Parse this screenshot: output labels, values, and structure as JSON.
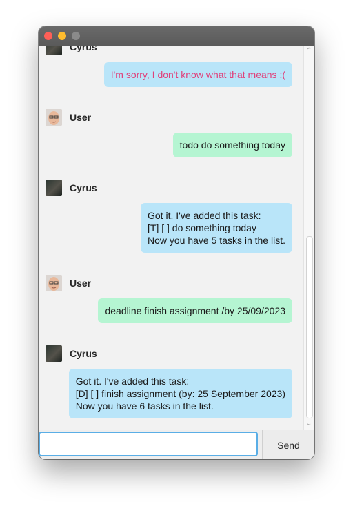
{
  "window": {
    "controls": [
      "close",
      "minimize",
      "maximize"
    ]
  },
  "messages": [
    {
      "sender": "Cyrus",
      "avatar": "cyrus-avatar",
      "lines": [
        "I'm sorry, I don't know what that means :("
      ],
      "kind": "error"
    },
    {
      "sender": "User",
      "avatar": "user-avatar",
      "lines": [
        "todo do something today"
      ],
      "kind": "user"
    },
    {
      "sender": "Cyrus",
      "avatar": "cyrus-avatar",
      "lines": [
        "Got it. I've added this task:",
        "[T] [ ] do something today",
        "Now you have 5 tasks in the list."
      ],
      "kind": "bot"
    },
    {
      "sender": "User",
      "avatar": "user-avatar",
      "lines": [
        "deadline finish assignment /by 25/09/2023"
      ],
      "kind": "user"
    },
    {
      "sender": "Cyrus",
      "avatar": "cyrus-avatar",
      "lines": [
        "Got it. I've added this task:",
        "[D] [ ] finish assignment (by: 25 September 2023)",
        "Now you have 6 tasks in the list."
      ],
      "kind": "bot"
    }
  ],
  "input": {
    "value": "",
    "placeholder": ""
  },
  "send_label": "Send",
  "colors": {
    "bot_bubble": "#b9e5f9",
    "user_bubble": "#b5f5d2",
    "error_text": "#e0417b",
    "input_focus": "#5aaee6"
  }
}
